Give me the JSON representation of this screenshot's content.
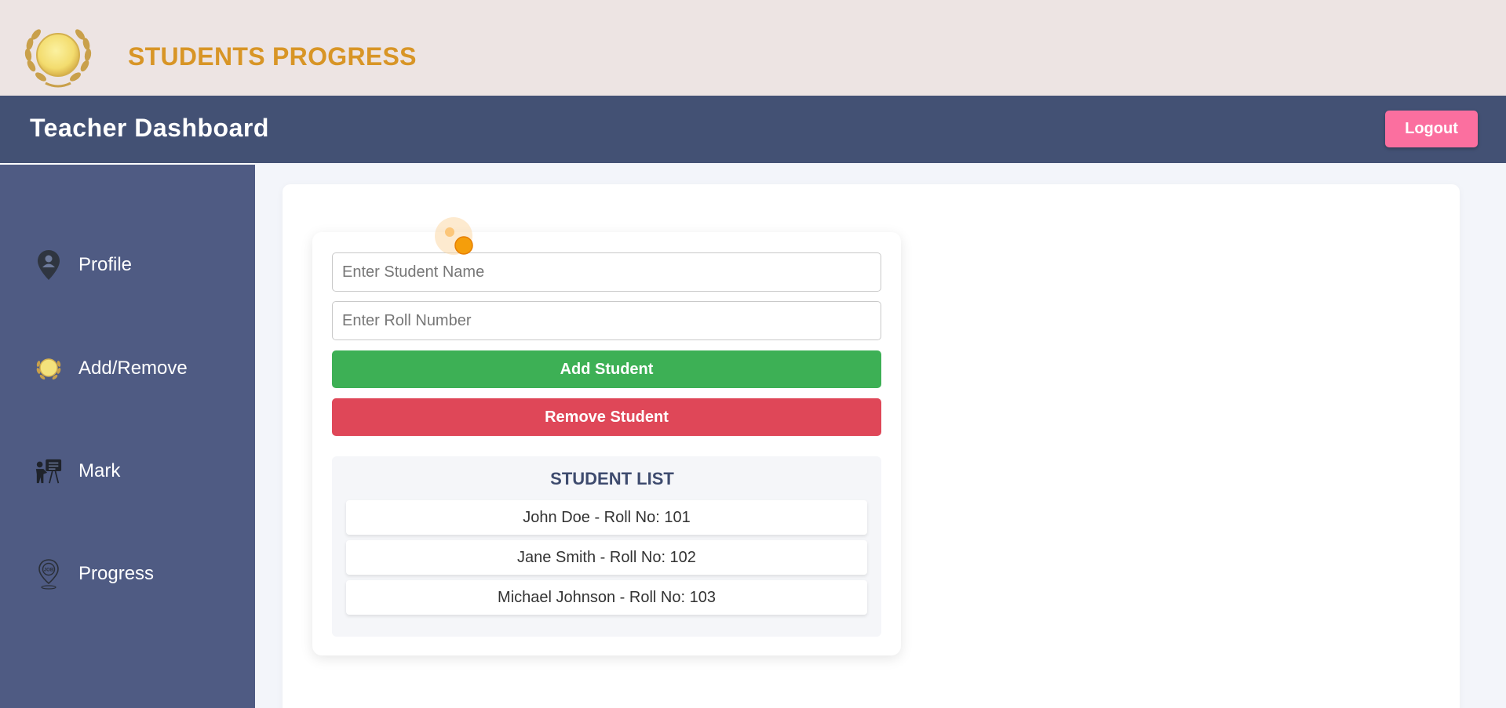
{
  "brand": {
    "title": "STUDENTS PROGRESS",
    "logo_icon": "laurel-medal-icon"
  },
  "header": {
    "title": "Teacher Dashboard",
    "logout_label": "Logout"
  },
  "sidebar": {
    "items": [
      {
        "label": "Profile",
        "icon": "location-user-icon"
      },
      {
        "label": "Add/Remove",
        "icon": "laurel-medal-icon"
      },
      {
        "label": "Mark",
        "icon": "teacher-board-icon"
      },
      {
        "label": "Progress",
        "icon": "job-pin-icon"
      }
    ]
  },
  "form": {
    "name_placeholder": "Enter Student Name",
    "roll_placeholder": "Enter Roll Number",
    "add_label": "Add Student",
    "remove_label": "Remove Student"
  },
  "student_list": {
    "title": "STUDENT LIST",
    "items": [
      "John Doe - Roll No: 101",
      "Jane Smith - Roll No: 102",
      "Michael Johnson - Roll No: 103"
    ]
  },
  "colors": {
    "accent": "#d89526",
    "header_bg": "#435174",
    "sidebar_bg": "#4f5b83",
    "logout": "#fb6f9f",
    "add": "#3db055",
    "remove": "#df4758"
  }
}
